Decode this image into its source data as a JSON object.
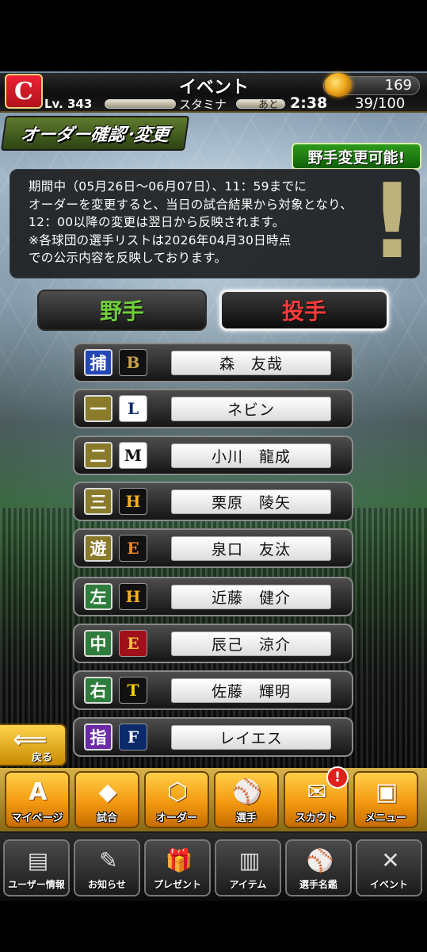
{
  "header": {
    "title": "イベント",
    "team_logo": "C",
    "ball_count": "169",
    "level": "Lv. 343",
    "stamina_label": "スタミナ",
    "ato_label": "あと",
    "timer": "2:38",
    "stamina": "39/100"
  },
  "section": {
    "title": "オーダー確認･変更",
    "badge": "野手変更可能!"
  },
  "notice": {
    "lines": [
      "期間中（05月26日〜06月07日）、11：59までに",
      "オーダーを変更すると、当日の試合結果から対象となり、",
      "12：00以降の変更は翌日から反映されます。",
      "※各球団の選手リストは2026年04月30日時点",
      "での公示内容を反映しております。"
    ]
  },
  "tabs": {
    "fielder": "野手",
    "pitcher": "投手"
  },
  "order": [
    {
      "position": "捕",
      "team": "B",
      "name": "森　友哉"
    },
    {
      "position": "一",
      "team": "L",
      "name": "ネビン"
    },
    {
      "position": "二",
      "team": "M",
      "name": "小川　龍成"
    },
    {
      "position": "三",
      "team": "H",
      "name": "栗原　陵矢"
    },
    {
      "position": "遊",
      "team": "E",
      "name": "泉口　友汰"
    },
    {
      "position": "左",
      "team": "H",
      "name": "近藤　健介"
    },
    {
      "position": "中",
      "team": "E",
      "name": "辰己　涼介"
    },
    {
      "position": "右",
      "team": "T",
      "name": "佐藤　輝明"
    },
    {
      "position": "指",
      "team": "F",
      "name": "レイエス"
    }
  ],
  "back_label": "戻る",
  "main_menu": [
    {
      "label": "マイページ",
      "icon": "A"
    },
    {
      "label": "試合",
      "icon": "◆"
    },
    {
      "label": "オーダー",
      "icon": "⬡"
    },
    {
      "label": "選手",
      "icon": "⚾"
    },
    {
      "label": "スカウト",
      "icon": "✉"
    },
    {
      "label": "メニュー",
      "icon": "▣"
    }
  ],
  "scout_badge": "!",
  "sub_menu": [
    {
      "label": "ユーザー情報",
      "icon": "▤"
    },
    {
      "label": "お知らせ",
      "icon": "✎"
    },
    {
      "label": "プレゼント",
      "icon": "🎁"
    },
    {
      "label": "アイテム",
      "icon": "▥"
    },
    {
      "label": "選手名鑑",
      "icon": "⚾"
    },
    {
      "label": "イベント",
      "icon": "✕"
    }
  ]
}
